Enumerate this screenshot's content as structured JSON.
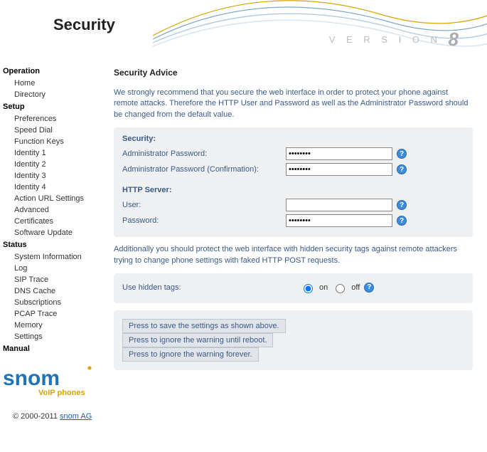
{
  "header": {
    "title": "Security",
    "version_prefix": "V E R S I O N",
    "version_number": "8"
  },
  "sidebar": {
    "groups": [
      {
        "label": "Operation",
        "items": [
          "Home",
          "Directory"
        ]
      },
      {
        "label": "Setup",
        "items": [
          "Preferences",
          "Speed Dial",
          "Function Keys",
          "Identity 1",
          "Identity 2",
          "Identity 3",
          "Identity 4",
          "Action URL Settings",
          "Advanced",
          "Certificates",
          "Software Update"
        ]
      },
      {
        "label": "Status",
        "items": [
          "System Information",
          "Log",
          "SIP Trace",
          "DNS Cache",
          "Subscriptions",
          "PCAP Trace",
          "Memory",
          "Settings"
        ]
      },
      {
        "label": "Manual",
        "items": []
      }
    ]
  },
  "logo": {
    "brand": "snom",
    "tagline": "VoIP phones"
  },
  "footer": {
    "copyright": "© 2000-2011 ",
    "link": "snom AG"
  },
  "content": {
    "heading": "Security Advice",
    "intro": "We strongly recommend that you secure the web interface in order to protect your phone against remote attacks. Therefore the HTTP User and Password as well as the Administrator Password should be changed from the default value.",
    "security_section": "Security:",
    "admin_pw_label": "Administrator Password:",
    "admin_pw_value": "••••••••",
    "admin_pw_conf_label": "Administrator Password (Confirmation):",
    "admin_pw_conf_value": "••••••••",
    "http_section": "HTTP Server:",
    "http_user_label": "User:",
    "http_user_value": "",
    "http_pw_label": "Password:",
    "http_pw_value": "••••••••",
    "hidden_intro": "Additionally you should protect the web interface with hidden security tags against remote attackers trying to change phone settings with faked HTTP POST requests.",
    "hidden_label": "Use hidden tags:",
    "radio_on": "on",
    "radio_off": "off",
    "btn_save": "Press to save the settings as shown above.",
    "btn_ignore_reboot": "Press to ignore the warning until reboot.",
    "btn_ignore_forever": "Press to ignore the warning forever."
  }
}
